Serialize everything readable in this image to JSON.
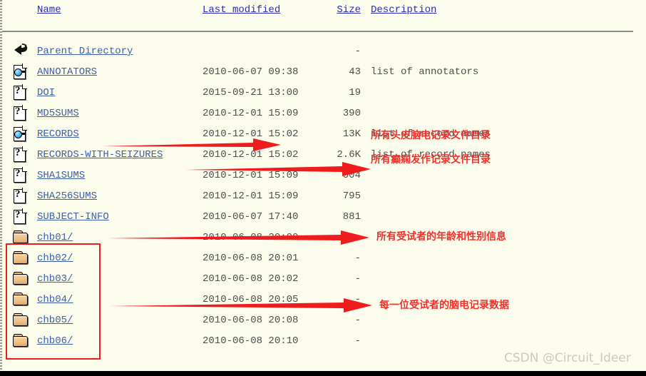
{
  "columns": {
    "name": "Name",
    "last_modified": "Last modified",
    "size": "Size",
    "description": "Description"
  },
  "rows": [
    {
      "icon": "back-icon",
      "name": "Parent Directory",
      "last_modified": "",
      "size": "-",
      "description": ""
    },
    {
      "icon": "text-file-icon",
      "name": "ANNOTATORS",
      "last_modified": "2010-06-07 09:38",
      "size": "43",
      "description": "list of annotators"
    },
    {
      "icon": "unknown-file-icon",
      "name": "DOI",
      "last_modified": "2015-09-21 13:00",
      "size": "19",
      "description": ""
    },
    {
      "icon": "unknown-file-icon",
      "name": "MD5SUMS",
      "last_modified": "2010-12-01 15:09",
      "size": "390",
      "description": ""
    },
    {
      "icon": "text-file-icon",
      "name": "RECORDS",
      "last_modified": "2010-12-01 15:02",
      "size": "13K",
      "description": "list of record names"
    },
    {
      "icon": "unknown-file-icon",
      "name": "RECORDS-WITH-SEIZURES",
      "last_modified": "2010-12-01 15:02",
      "size": "2.6K",
      "description": "list of record names"
    },
    {
      "icon": "unknown-file-icon",
      "name": "SHA1SUMS",
      "last_modified": "2010-12-01 15:09",
      "size": "504",
      "description": ""
    },
    {
      "icon": "unknown-file-icon",
      "name": "SHA256SUMS",
      "last_modified": "2010-12-01 15:09",
      "size": "795",
      "description": ""
    },
    {
      "icon": "unknown-file-icon",
      "name": "SUBJECT-INFO",
      "last_modified": "2010-06-07 17:40",
      "size": "881",
      "description": ""
    },
    {
      "icon": "folder-icon",
      "name": "chb01/",
      "last_modified": "2010-06-08 20:00",
      "size": "-",
      "description": ""
    },
    {
      "icon": "folder-icon",
      "name": "chb02/",
      "last_modified": "2010-06-08 20:01",
      "size": "-",
      "description": ""
    },
    {
      "icon": "folder-icon",
      "name": "chb03/",
      "last_modified": "2010-06-08 20:02",
      "size": "-",
      "description": ""
    },
    {
      "icon": "folder-icon",
      "name": "chb04/",
      "last_modified": "2010-06-08 20:05",
      "size": "-",
      "description": ""
    },
    {
      "icon": "folder-icon",
      "name": "chb05/",
      "last_modified": "2010-06-08 20:08",
      "size": "-",
      "description": ""
    },
    {
      "icon": "folder-icon",
      "name": "chb06/",
      "last_modified": "2010-06-08 20:10",
      "size": "-",
      "description": ""
    }
  ],
  "annotations": {
    "note_records": "所有头皮脑电记录文件目录",
    "note_seizures": "所有癫痫发作记录文件目录",
    "note_subject_info": "所有受试者的年龄和性别信息",
    "note_chb_folders": "每一位受试者的脑电记录数据",
    "accent_color": "#f0302a",
    "box_color": "#ee1c1c"
  },
  "watermark": "CSDN @Circuit_Ideer"
}
